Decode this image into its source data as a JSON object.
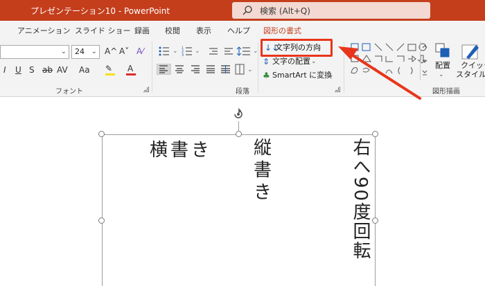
{
  "titlebar": {
    "title": "プレゼンテーション10  -  PowerPoint",
    "search_placeholder": "検索 (Alt+Q)",
    "search_icon": "search-icon"
  },
  "tabs": [
    {
      "label": "アニメーション",
      "active": false
    },
    {
      "label": "スライド ショー",
      "active": false
    },
    {
      "label": "録画",
      "active": false
    },
    {
      "label": "校閲",
      "active": false
    },
    {
      "label": "表示",
      "active": false
    },
    {
      "label": "ヘルプ",
      "active": false
    },
    {
      "label": "図形の書式",
      "active": true
    }
  ],
  "font_group": {
    "font_name": "",
    "font_size": "24",
    "grow_icon": "A^",
    "shrink_icon": "A˅",
    "clear_format_icon": "A⁄",
    "italic": "I",
    "underline": "U",
    "shadow": "S",
    "strike": "ab",
    "spacing": "AV",
    "case": "Aa",
    "label": "フォント"
  },
  "paragraph_group": {
    "text_direction_label": "文字列の方向",
    "align_text_label": "文字の配置",
    "smartart_label": "SmartArt に変換",
    "label": "段落"
  },
  "drawing_group": {
    "arrange_label": "配置",
    "quick_style_label_1": "クイック",
    "quick_style_label_2": "スタイル",
    "label": "図形描画"
  },
  "slide": {
    "horizontal_text": "横書き",
    "vertical_text": "縦書き",
    "rotated_text": "右へ90度回転"
  },
  "colors": {
    "brand": "#c43e1c",
    "highlight_box": "#e8351a",
    "arrow": "#e8351a",
    "highlight_color": "#f7e11b",
    "font_color": "#e02a2a"
  }
}
